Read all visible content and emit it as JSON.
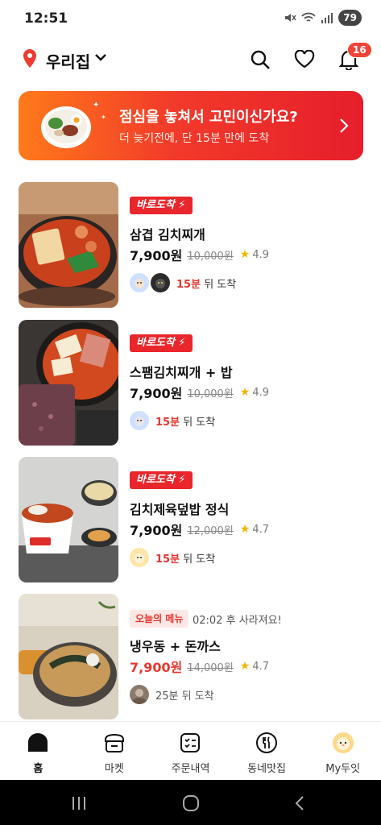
{
  "status_bar": {
    "time": "12:51",
    "battery": "79"
  },
  "header": {
    "location": "우리집",
    "notification_count": "16"
  },
  "banner": {
    "title": "점심을 놓쳐서 고민이신가요?",
    "subtitle": "더 늦기전에, 단 15분 만에 도착"
  },
  "items": [
    {
      "tag": "바로도착",
      "name": "삼겹 김치찌개",
      "price": "7,900원",
      "original_price": "10,000원",
      "rating": "4.9",
      "eta_minutes": "15분",
      "eta_suffix": " 뒤 도착"
    },
    {
      "tag": "바로도착",
      "name": "스팸김치찌개 + 밥",
      "price": "7,900원",
      "original_price": "10,000원",
      "rating": "4.9",
      "eta_minutes": "15분",
      "eta_suffix": " 뒤 도착"
    },
    {
      "tag": "바로도착",
      "name": "김치제육덮밥 정식",
      "price": "7,900원",
      "original_price": "12,000원",
      "rating": "4.7",
      "eta_minutes": "15분",
      "eta_suffix": " 뒤 도착"
    },
    {
      "tag": "오늘의 메뉴",
      "expire_note": "02:02 후 사라져요!",
      "name": "냉우동 + 돈까스",
      "price": "7,900원",
      "original_price": "14,000원",
      "rating": "4.7",
      "eta_text": "25분 뒤 도착"
    }
  ],
  "bottom_nav": [
    {
      "label": "홈",
      "icon": "home-icon",
      "active": true
    },
    {
      "label": "마켓",
      "icon": "market-icon"
    },
    {
      "label": "주문내역",
      "icon": "order-list-icon"
    },
    {
      "label": "동네맛집",
      "icon": "restaurant-icon"
    },
    {
      "label": "My두잇",
      "icon": "profile-hamster-icon"
    }
  ],
  "colors": {
    "accent": "#e8262b",
    "price_red": "#e5372e",
    "star": "#f5b400"
  }
}
